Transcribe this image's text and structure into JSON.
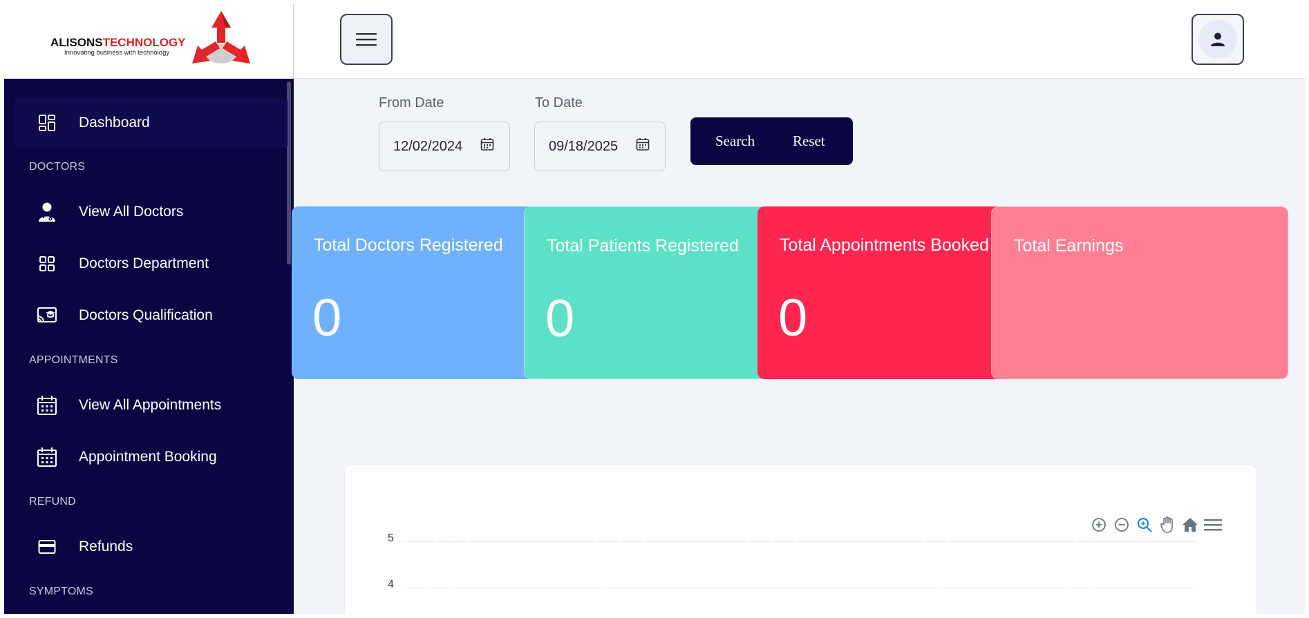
{
  "brand": {
    "name_part1": "ALISONS",
    "name_part2": "TECHNOLOGY",
    "tagline": "Innovating business with technology"
  },
  "header": {
    "menu_icon": "hamburger-icon",
    "user_icon": "user-icon"
  },
  "sidebar": {
    "items": [
      {
        "label": "Dashboard",
        "icon": "dashboard-icon",
        "active": true
      },
      {
        "section": "DOCTORS"
      },
      {
        "label": "View All Doctors",
        "icon": "doctor-icon"
      },
      {
        "label": "Doctors Department",
        "icon": "grid-icon"
      },
      {
        "label": "Doctors Qualification",
        "icon": "qualification-icon"
      },
      {
        "section": "APPOINTMENTS"
      },
      {
        "label": "View All Appointments",
        "icon": "calendar-icon"
      },
      {
        "label": "Appointment Booking",
        "icon": "calendar-icon"
      },
      {
        "section": "REFUND"
      },
      {
        "label": "Refunds",
        "icon": "card-icon"
      },
      {
        "section": "SYMPTOMS"
      }
    ]
  },
  "filters": {
    "from_label": "From Date",
    "from_value": "12/02/2024",
    "to_label": "To Date",
    "to_value": "09/18/2025",
    "search_label": "Search",
    "reset_label": "Reset"
  },
  "cards": [
    {
      "title": "Total Doctors Registered",
      "value": "0",
      "color": "#6fb1fc"
    },
    {
      "title": "Total Patients Registered",
      "value": "0",
      "color": "#5ce0c6"
    },
    {
      "title": "Total Appointments Booked",
      "value": "0",
      "color": "#ff2650"
    },
    {
      "title": "Total Earnings",
      "value": "",
      "color": "#ff7f93"
    }
  ],
  "chart_data": {
    "type": "line",
    "yticks": [
      "5",
      "4"
    ],
    "toolbar": [
      "zoom-in-icon",
      "zoom-out-icon",
      "zoom-select-icon",
      "pan-hand-icon",
      "home-icon",
      "menu-icon"
    ]
  }
}
